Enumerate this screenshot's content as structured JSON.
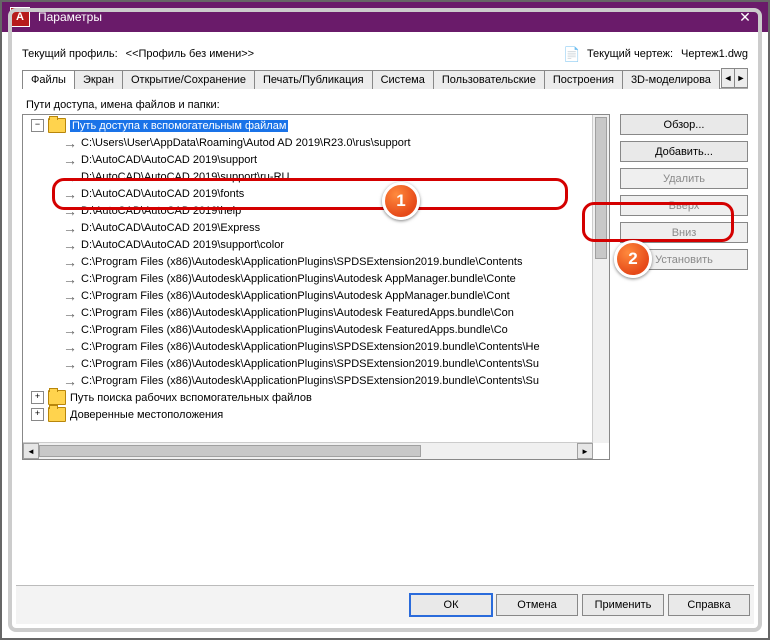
{
  "window": {
    "title": "Параметры"
  },
  "header": {
    "profile_label": "Текущий профиль:",
    "profile_value": "<<Профиль без имени>>",
    "drawing_label": "Текущий чертеж:",
    "drawing_value": "Чертеж1.dwg"
  },
  "tabs": [
    "Файлы",
    "Экран",
    "Открытие/Сохранение",
    "Печать/Публикация",
    "Система",
    "Пользовательские",
    "Построения",
    "3D-моделирова"
  ],
  "section_label": "Пути доступа, имена файлов и папки:",
  "tree": {
    "root0": {
      "label": "Путь доступа к вспомогательным файлам",
      "children": [
        "C:\\Users\\User\\AppData\\Roaming\\Autod            AD 2019\\R23.0\\rus\\support",
        "D:\\AutoCAD\\AutoCAD 2019\\support",
        "D:\\AutoCAD\\AutoCAD 2019\\support\\ru-RU",
        "D:\\AutoCAD\\AutoCAD 2019\\fonts",
        "D:\\AutoCAD\\AutoCAD 2019\\help",
        "D:\\AutoCAD\\AutoCAD 2019\\Express",
        "D:\\AutoCAD\\AutoCAD 2019\\support\\color",
        "C:\\Program Files (x86)\\Autodesk\\ApplicationPlugins\\SPDSExtension2019.bundle\\Contents",
        "C:\\Program Files (x86)\\Autodesk\\ApplicationPlugins\\Autodesk AppManager.bundle\\Conte",
        "C:\\Program Files (x86)\\Autodesk\\ApplicationPlugins\\Autodesk AppManager.bundle\\Cont",
        "C:\\Program Files (x86)\\Autodesk\\ApplicationPlugins\\Autodesk FeaturedApps.bundle\\Con",
        "C:\\Program Files (x86)\\Autodesk\\ApplicationPlugins\\Autodesk FeaturedApps.bundle\\Co",
        "C:\\Program Files (x86)\\Autodesk\\ApplicationPlugins\\SPDSExtension2019.bundle\\Contents\\He",
        "C:\\Program Files (x86)\\Autodesk\\ApplicationPlugins\\SPDSExtension2019.bundle\\Contents\\Su",
        "C:\\Program Files (x86)\\Autodesk\\ApplicationPlugins\\SPDSExtension2019.bundle\\Contents\\Su"
      ]
    },
    "root1": {
      "label": "Путь поиска рабочих вспомогательных файлов"
    },
    "root2": {
      "label": "Доверенные местоположения"
    }
  },
  "buttons": {
    "browse": "Обзор...",
    "add": "Добавить...",
    "remove": "Удалить",
    "up": "Вверх",
    "down": "Вниз",
    "setcurrent": "Установить"
  },
  "dialog": {
    "ok": "ОК",
    "cancel": "Отмена",
    "apply": "Применить",
    "help": "Справка"
  },
  "callouts": [
    "1",
    "2"
  ]
}
